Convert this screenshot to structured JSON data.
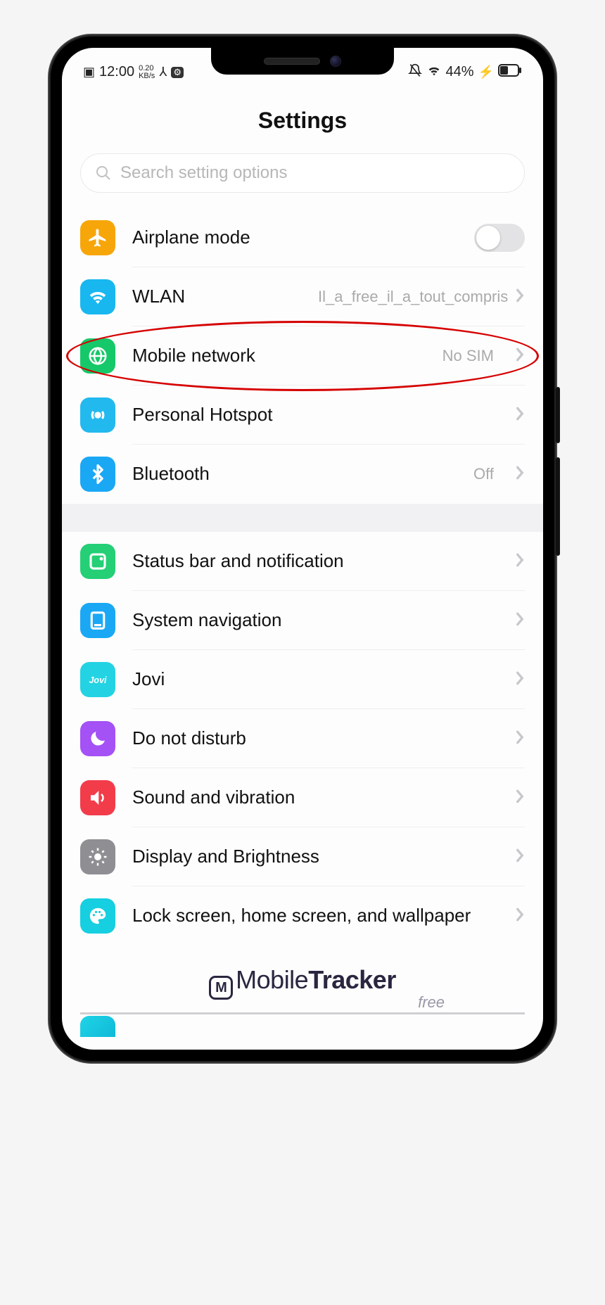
{
  "statusbar": {
    "time": "12:00",
    "kbs_top": "0.20",
    "kbs_bottom": "KB/s",
    "battery_pct": "44%"
  },
  "header": {
    "title": "Settings"
  },
  "search": {
    "placeholder": "Search setting options"
  },
  "groups": [
    {
      "rows": [
        {
          "id": "airplane",
          "icon": "airplane",
          "icon_bg": "#f7a60a",
          "label": "Airplane mode",
          "toggle": true
        },
        {
          "id": "wlan",
          "icon": "wifi",
          "icon_bg": "#18b7ef",
          "label": "WLAN",
          "value": "Il_a_free_il_a_tout_compris",
          "chevron": true
        },
        {
          "id": "mobile",
          "icon": "globe",
          "icon_bg": "#15c869",
          "label": "Mobile network",
          "value": "No SIM",
          "chevron": true,
          "highlighted": true
        },
        {
          "id": "hotspot",
          "icon": "hotspot",
          "icon_bg": "#22b9ef",
          "label": "Personal Hotspot",
          "chevron": true
        },
        {
          "id": "bluetooth",
          "icon": "bluetooth",
          "icon_bg": "#1aa8f5",
          "label": "Bluetooth",
          "value": "Off",
          "chevron": true
        }
      ]
    },
    {
      "rows": [
        {
          "id": "status",
          "icon": "statusbar",
          "icon_bg": "#24cf76",
          "label": "Status bar and notification",
          "chevron": true
        },
        {
          "id": "nav",
          "icon": "nav",
          "icon_bg": "#1aa8f5",
          "label": "System navigation",
          "chevron": true
        },
        {
          "id": "jovi",
          "icon": "jovi",
          "icon_bg": "#24d3e3",
          "label": "Jovi",
          "chevron": true
        },
        {
          "id": "dnd",
          "icon": "moon",
          "icon_bg": "#a451f5",
          "label": "Do not disturb",
          "chevron": true
        },
        {
          "id": "sound",
          "icon": "sound",
          "icon_bg": "#f23c4a",
          "label": "Sound and vibration",
          "chevron": true
        },
        {
          "id": "display",
          "icon": "brightness",
          "icon_bg": "#8e8e93",
          "label": "Display and Brightness",
          "chevron": true
        },
        {
          "id": "lock",
          "icon": "palette",
          "icon_bg": "#16cfe0",
          "label": "Lock screen, home screen, and wallpaper",
          "chevron": true
        }
      ]
    }
  ],
  "watermark": {
    "logo": "M",
    "brand_thin": "Mobile",
    "brand_bold": "Tracker",
    "sub": "free"
  }
}
